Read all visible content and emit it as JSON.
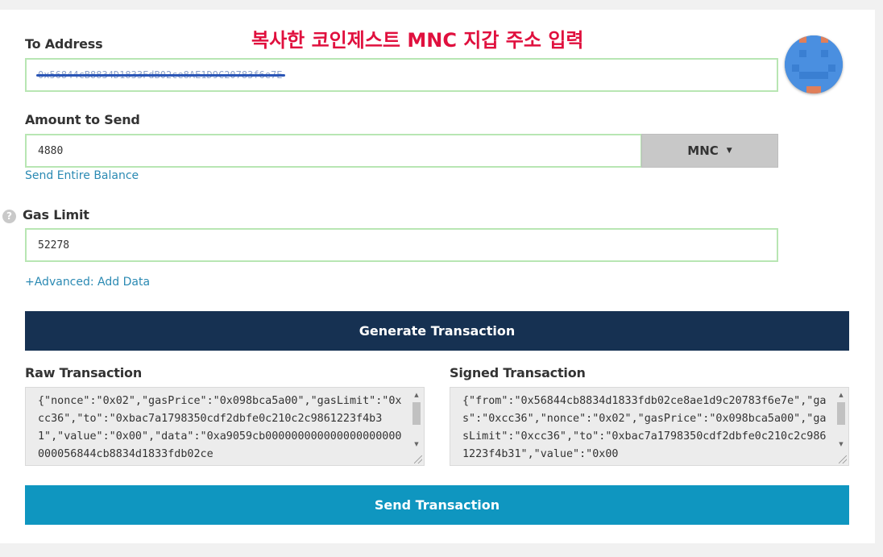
{
  "annotation": "복사한 코인제스트 MNC 지갑 주소 입력",
  "to_address": {
    "label": "To Address",
    "value": "0x56844cB8834D1833FdB02ce8AE1D9C20783f6e7E"
  },
  "amount": {
    "label": "Amount to Send",
    "value": "4880",
    "currency": "MNC",
    "send_entire_balance": "Send Entire Balance"
  },
  "gas": {
    "help_icon": "?",
    "label": "Gas Limit",
    "value": "52278"
  },
  "advanced_link": "+Advanced: Add Data",
  "generate_button": "Generate Transaction",
  "raw_tx": {
    "label": "Raw Transaction",
    "text": "{\"nonce\":\"0x02\",\"gasPrice\":\"0x098bca5a00\",\"gasLimit\":\"0xcc36\",\"to\":\"0xbac7a1798350cdf2dbfe0c210c2c9861223f4b31\",\"value\":\"0x00\",\"data\":\"0xa9059cb000000000000000000000000056844cb8834d1833fdb02ce"
  },
  "signed_tx": {
    "label": "Signed Transaction",
    "text": "{\"from\":\"0x56844cb8834d1833fdb02ce8ae1d9c20783f6e7e\",\"gas\":\"0xcc36\",\"nonce\":\"0x02\",\"gasPrice\":\"0x098bca5a00\",\"gasLimit\":\"0xcc36\",\"to\":\"0xbac7a1798350cdf2dbfe0c210c2c9861223f4b31\",\"value\":\"0x00"
  },
  "send_button": "Send Transaction",
  "colors": {
    "navy_button": "#163152",
    "send_button": "#0f96c0",
    "link": "#2b8ab3",
    "annotation_red": "#e0103e",
    "field_border": "#b8e6b3"
  },
  "icons": {
    "identicon": "identicon-avatar",
    "help": "help-icon",
    "dropdown": "caret-down-icon",
    "scroll_up": "scroll-up-arrow-icon",
    "scroll_down": "scroll-down-arrow-icon",
    "resize": "resize-grip-icon"
  }
}
